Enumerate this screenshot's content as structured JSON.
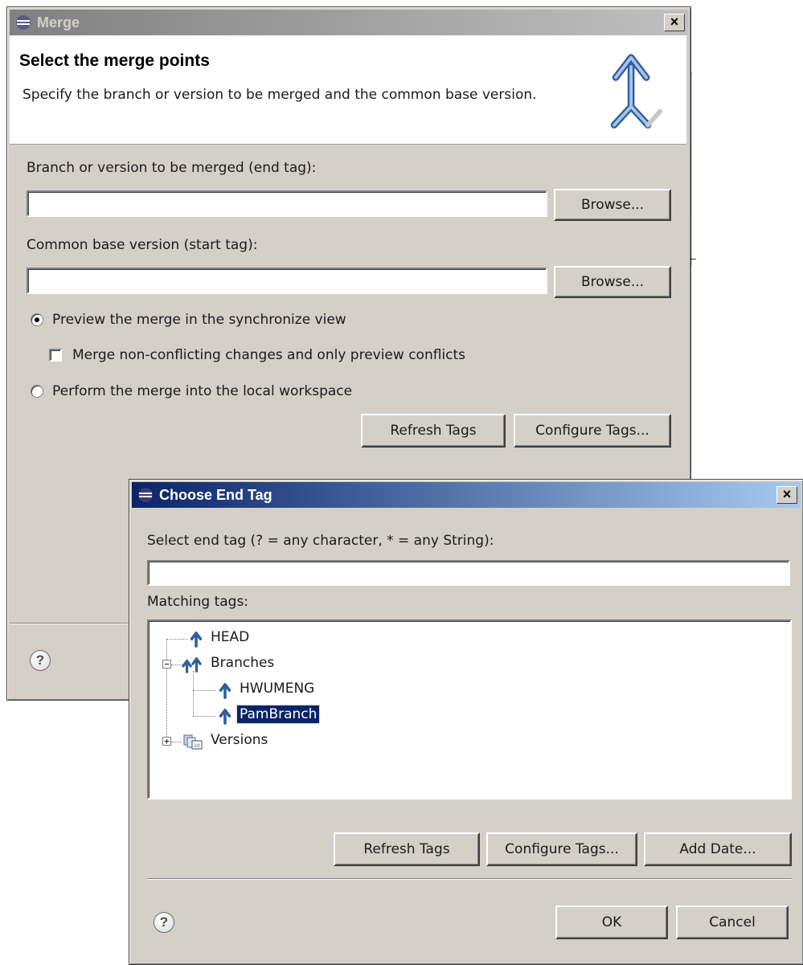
{
  "merge_dialog": {
    "title": "Merge",
    "close_label": "×",
    "banner_title": "Select the merge points",
    "banner_desc": "Specify the branch or version to be merged and the common base version.",
    "end_tag_label": "Branch or version to be merged (end tag):",
    "end_tag_value": "",
    "browse_label": "Browse...",
    "start_tag_label": "Common base version (start tag):",
    "start_tag_value": "",
    "radio_preview": "Preview the merge in the synchronize view",
    "checkbox_nonconflict": "Merge non-conflicting changes and only preview conflicts",
    "radio_perform": "Perform the merge into the local workspace",
    "refresh_tags": "Refresh Tags",
    "configure_tags": "Configure Tags...",
    "help": "?"
  },
  "choose_dialog": {
    "title": "Choose End Tag",
    "close_label": "×",
    "filter_label": "Select end tag (? = any character, * = any String):",
    "filter_value": "",
    "matching_label": "Matching tags:",
    "tree": {
      "head": "HEAD",
      "branches": "Branches",
      "branch_items": [
        "HWUMENG",
        "PamBranch"
      ],
      "versions": "Versions",
      "selected": "PamBranch"
    },
    "refresh_tags": "Refresh Tags",
    "configure_tags": "Configure Tags...",
    "add_date": "Add Date...",
    "ok": "OK",
    "cancel": "Cancel",
    "help": "?"
  },
  "colors": {
    "dialog_bg": "#d4d0c8",
    "active_title": "#0a246a",
    "tag_icon": "#2e5fa0",
    "selection": "#0a246a"
  }
}
